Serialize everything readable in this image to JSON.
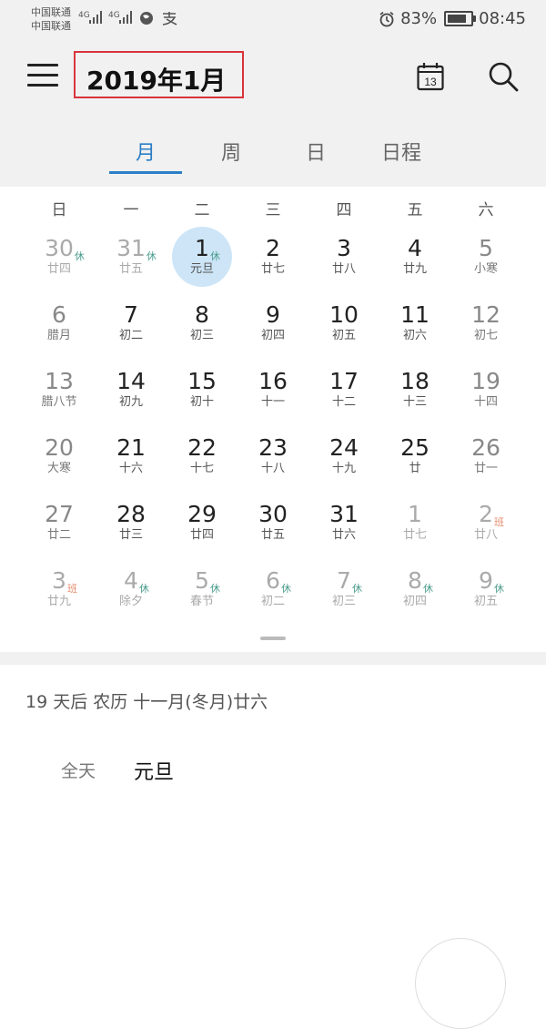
{
  "status_bar": {
    "carrier1": "中国联通",
    "carrier2": "中国联通",
    "net1": "4G",
    "net2": "4G",
    "battery_text": "83%",
    "battery_level": 0.83,
    "time": "08:45"
  },
  "header": {
    "title": "2019年1月"
  },
  "tabs": [
    {
      "label": "月",
      "active": true
    },
    {
      "label": "周",
      "active": false
    },
    {
      "label": "日",
      "active": false
    },
    {
      "label": "日程",
      "active": false
    }
  ],
  "weekdays": [
    "日",
    "一",
    "二",
    "三",
    "四",
    "五",
    "六"
  ],
  "weeks": [
    [
      {
        "num": "30",
        "sub": "廿四",
        "tag": "休",
        "tag_type": "rest",
        "muted": true
      },
      {
        "num": "31",
        "sub": "廿五",
        "tag": "休",
        "tag_type": "rest",
        "muted": true
      },
      {
        "num": "1",
        "sub": "元旦",
        "tag": "休",
        "tag_type": "rest",
        "selected": true
      },
      {
        "num": "2",
        "sub": "廿七"
      },
      {
        "num": "3",
        "sub": "廿八"
      },
      {
        "num": "4",
        "sub": "廿九"
      },
      {
        "num": "5",
        "sub": "小寒",
        "weekend": true
      }
    ],
    [
      {
        "num": "6",
        "sub": "腊月",
        "weekend": true
      },
      {
        "num": "7",
        "sub": "初二"
      },
      {
        "num": "8",
        "sub": "初三"
      },
      {
        "num": "9",
        "sub": "初四"
      },
      {
        "num": "10",
        "sub": "初五"
      },
      {
        "num": "11",
        "sub": "初六"
      },
      {
        "num": "12",
        "sub": "初七",
        "weekend": true
      }
    ],
    [
      {
        "num": "13",
        "sub": "腊八节",
        "weekend": true
      },
      {
        "num": "14",
        "sub": "初九"
      },
      {
        "num": "15",
        "sub": "初十"
      },
      {
        "num": "16",
        "sub": "十一"
      },
      {
        "num": "17",
        "sub": "十二"
      },
      {
        "num": "18",
        "sub": "十三"
      },
      {
        "num": "19",
        "sub": "十四",
        "weekend": true
      }
    ],
    [
      {
        "num": "20",
        "sub": "大寒",
        "weekend": true
      },
      {
        "num": "21",
        "sub": "十六"
      },
      {
        "num": "22",
        "sub": "十七"
      },
      {
        "num": "23",
        "sub": "十八"
      },
      {
        "num": "24",
        "sub": "十九"
      },
      {
        "num": "25",
        "sub": "廿"
      },
      {
        "num": "26",
        "sub": "廿一",
        "weekend": true
      }
    ],
    [
      {
        "num": "27",
        "sub": "廿二",
        "weekend": true
      },
      {
        "num": "28",
        "sub": "廿三"
      },
      {
        "num": "29",
        "sub": "廿四"
      },
      {
        "num": "30",
        "sub": "廿五"
      },
      {
        "num": "31",
        "sub": "廿六"
      },
      {
        "num": "1",
        "sub": "廿七",
        "muted": true
      },
      {
        "num": "2",
        "sub": "廿八",
        "tag": "班",
        "tag_type": "work",
        "muted": true
      }
    ],
    [
      {
        "num": "3",
        "sub": "廿九",
        "tag": "班",
        "tag_type": "work",
        "muted": true
      },
      {
        "num": "4",
        "sub": "除夕",
        "tag": "休",
        "tag_type": "rest",
        "muted": true
      },
      {
        "num": "5",
        "sub": "春节",
        "tag": "休",
        "tag_type": "rest",
        "muted": true
      },
      {
        "num": "6",
        "sub": "初二",
        "tag": "休",
        "tag_type": "rest",
        "muted": true
      },
      {
        "num": "7",
        "sub": "初三",
        "tag": "休",
        "tag_type": "rest",
        "muted": true
      },
      {
        "num": "8",
        "sub": "初四",
        "tag": "休",
        "tag_type": "rest",
        "muted": true
      },
      {
        "num": "9",
        "sub": "初五",
        "tag": "休",
        "tag_type": "rest",
        "muted": true
      }
    ]
  ],
  "detail": {
    "lunar_line": "19 天后  农历 十一月(冬月)廿六",
    "event_time": "全天",
    "event_name": "元旦"
  },
  "colors": {
    "accent": "#2a7fc7",
    "selected_bg": "#cde5f7",
    "rest_tag": "#4a9c8c",
    "work_tag": "#e58b6c",
    "highlight_border": "#d9343c"
  },
  "icons": [
    "menu-icon",
    "calendar-today-icon",
    "search-icon",
    "alarm-icon",
    "battery-icon",
    "signal-icon",
    "globe-icon",
    "alipay-icon"
  ]
}
